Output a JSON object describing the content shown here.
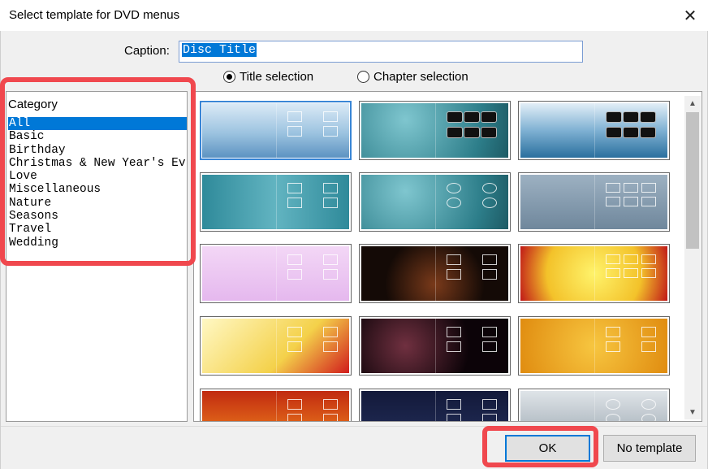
{
  "window": {
    "title": "Select template for DVD menus",
    "close_icon": "close-icon"
  },
  "caption": {
    "label": "Caption:",
    "value": "Disc Title"
  },
  "mode": {
    "title_selection": "Title selection",
    "chapter_selection": "Chapter selection",
    "selected": "Title selection"
  },
  "category": {
    "header": "Category",
    "items": [
      "All",
      "Basic",
      "Birthday",
      "Christmas & New Year's Ev",
      "Love",
      "Miscellaneous",
      "Nature",
      "Seasons",
      "Travel",
      "Wedding"
    ],
    "selected": "All"
  },
  "templates": [
    {
      "theme": "light-blue-waves",
      "layout": "boxes-4",
      "selected": true
    },
    {
      "theme": "teal-grunge",
      "layout": "dark-6"
    },
    {
      "theme": "blue-waves",
      "layout": "dark-6"
    },
    {
      "theme": "teal-lines",
      "layout": "boxes-4"
    },
    {
      "theme": "teal-grunge",
      "layout": "ovals-4"
    },
    {
      "theme": "grey-blue",
      "layout": "boxes-6"
    },
    {
      "theme": "party-balloons",
      "layout": "boxes-4"
    },
    {
      "theme": "birthday-cake",
      "layout": "boxes-4"
    },
    {
      "theme": "christmas-gold",
      "layout": "boxes-6"
    },
    {
      "theme": "christmas-tree",
      "layout": "boxes-4"
    },
    {
      "theme": "fireworks",
      "layout": "boxes-4"
    },
    {
      "theme": "gold-heart",
      "layout": "boxes-4"
    },
    {
      "theme": "autumn-red",
      "layout": "boxes-4"
    },
    {
      "theme": "dark-blue",
      "layout": "boxes-4"
    },
    {
      "theme": "silver",
      "layout": "ovals-4"
    }
  ],
  "buttons": {
    "ok": "OK",
    "no_template": "No template"
  },
  "colors": {
    "selection": "#0078d7",
    "annotation": "#f0484e"
  }
}
